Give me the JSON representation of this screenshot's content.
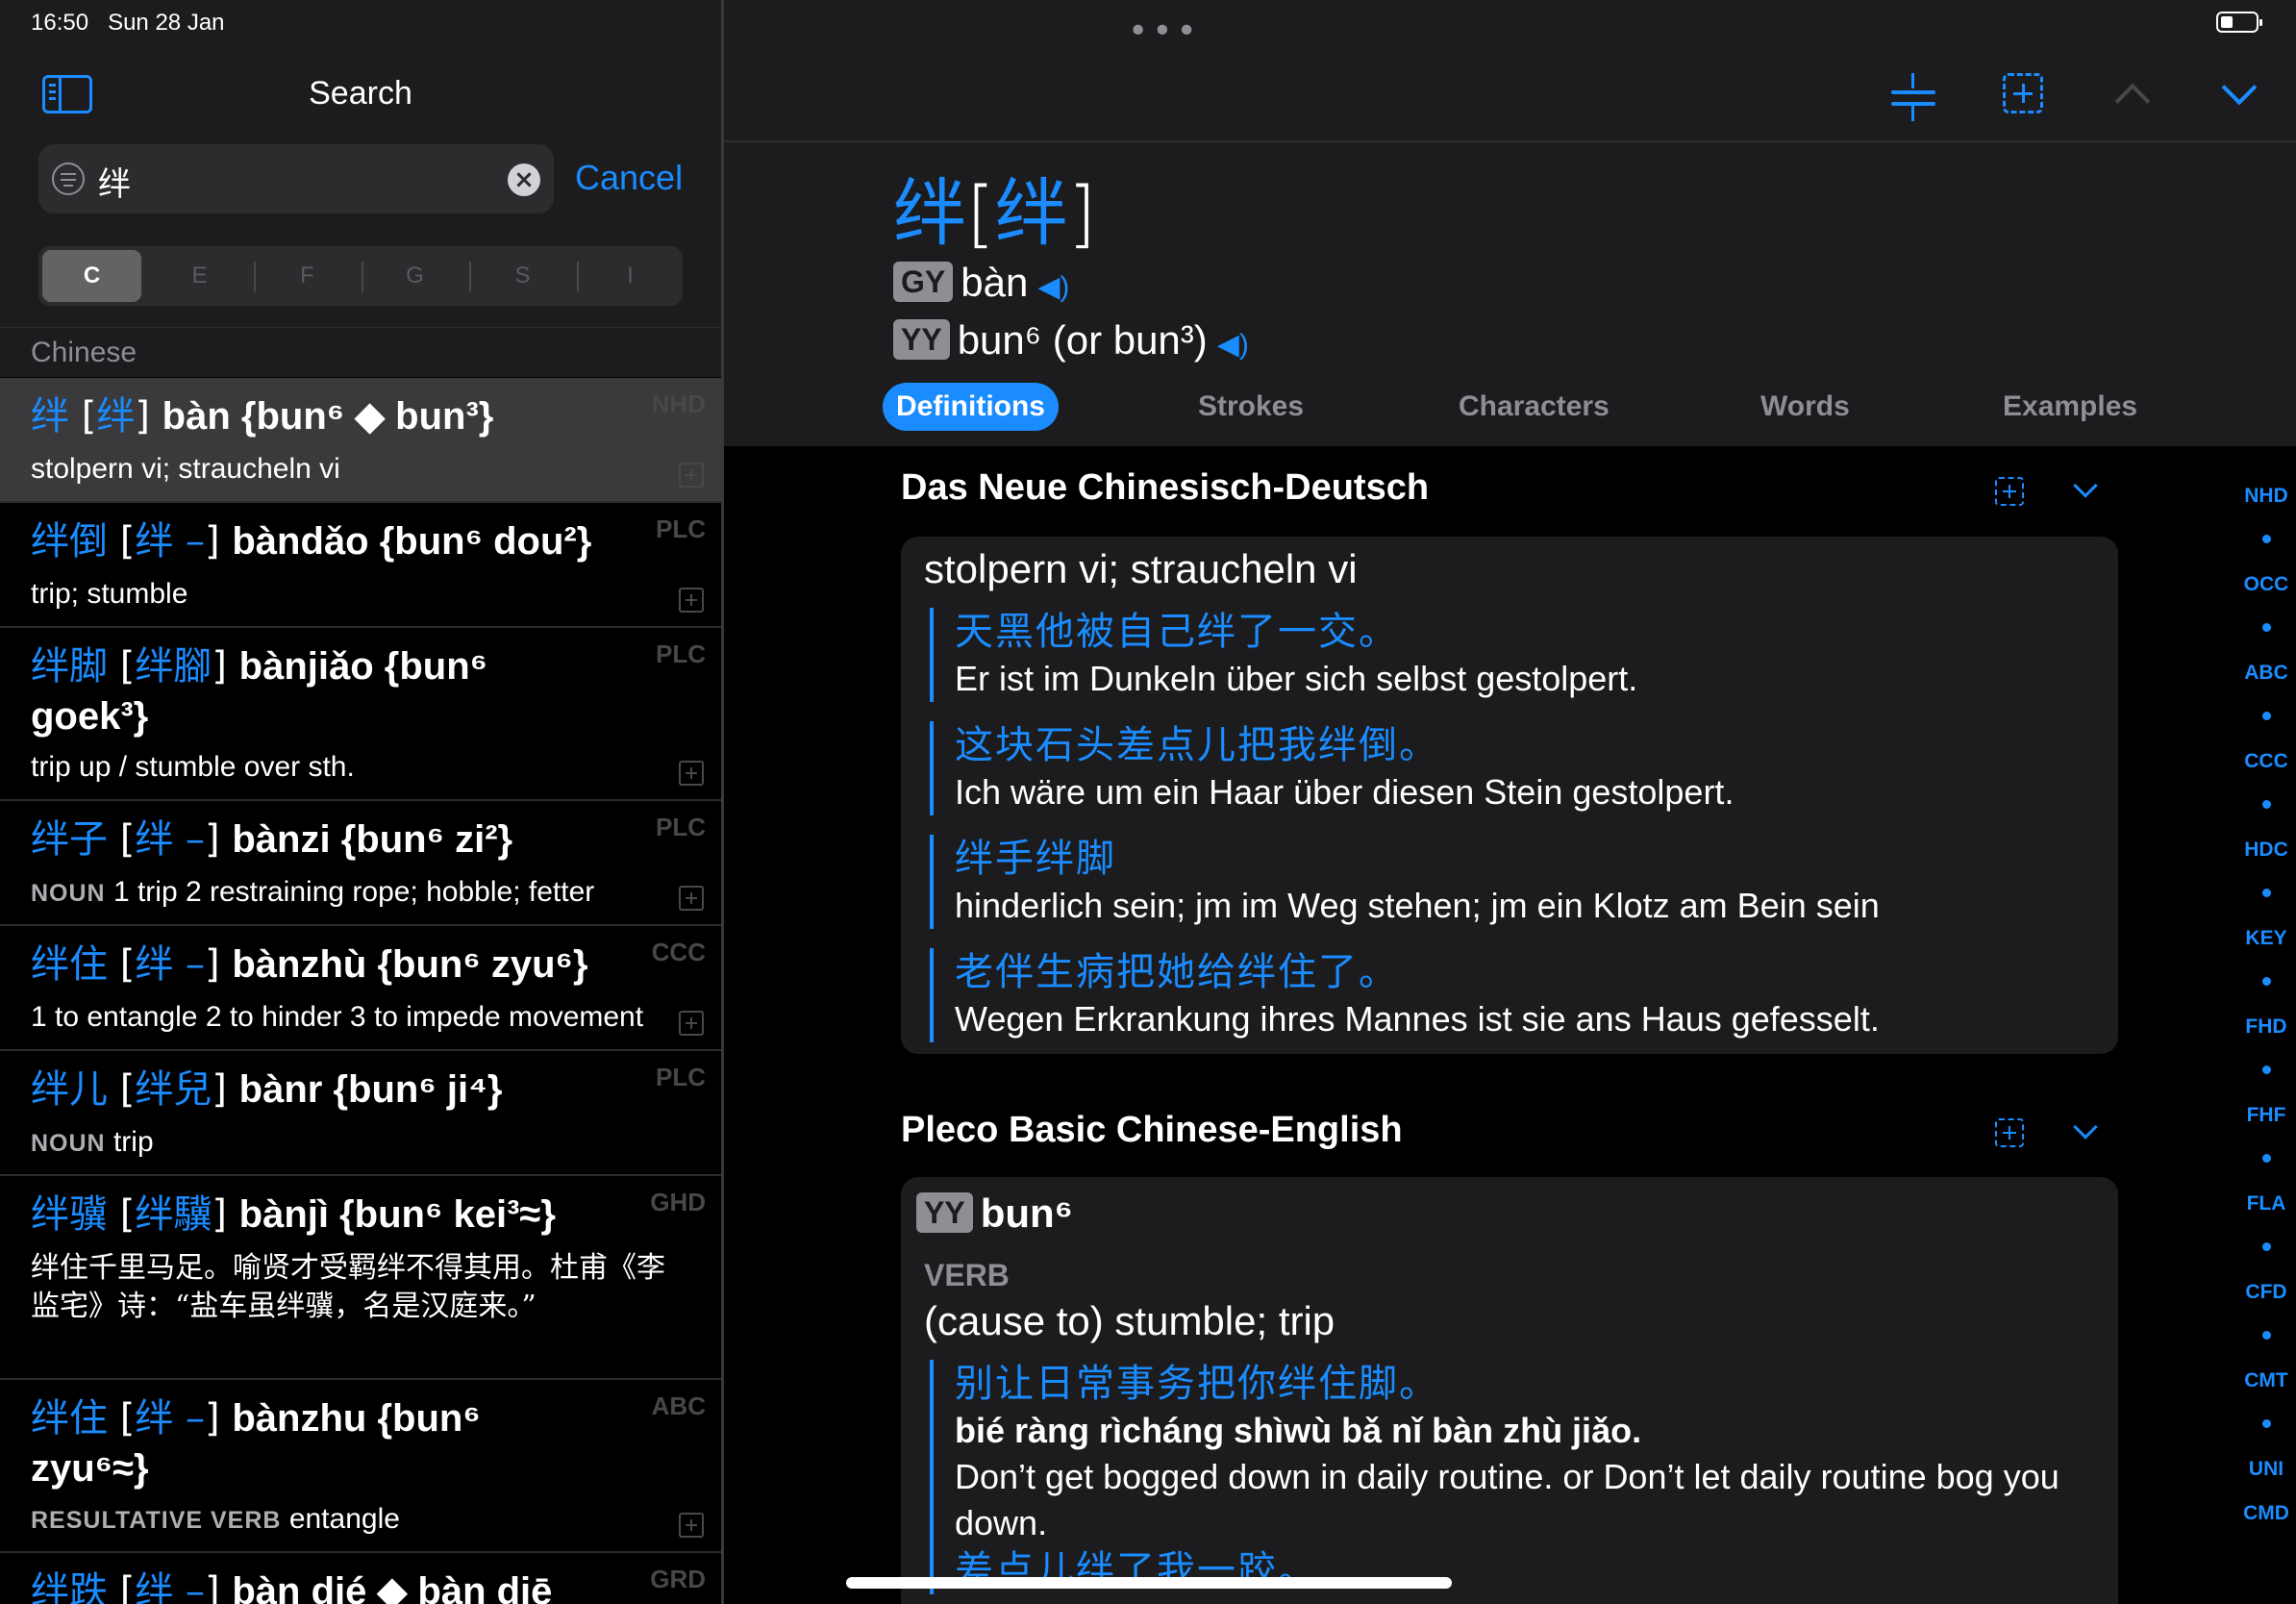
{
  "status": {
    "time": "16:50",
    "date": "Sun 28 Jan"
  },
  "search": {
    "title": "Search",
    "query": "绊",
    "cancel": "Cancel",
    "segments": [
      "C",
      "E",
      "F",
      "G",
      "S",
      "I"
    ],
    "active_segment": "C",
    "section": "Chinese"
  },
  "results": [
    {
      "hz": "绊",
      "trad": "绊",
      "py": "bàn {bun⁶ ◆ bun³}",
      "def": "stolpern vi; straucheln vi",
      "tag": "NHD"
    },
    {
      "hz": "绊倒",
      "trad": "绊 –",
      "py": "bàndǎo {bun⁶ dou²}",
      "def": "trip; stumble",
      "tag": "PLC"
    },
    {
      "hz": "绊脚",
      "trad": "绊腳",
      "py": "bànjiǎo {bun⁶",
      "py2": "goek³}",
      "def": "trip up / stumble over sth.",
      "tag": "PLC"
    },
    {
      "hz": "绊子",
      "trad": "绊 –",
      "py": "bànzi {bun⁶ zi²}",
      "pos": "NOUN",
      "def": "1 trip 2 restraining rope; hobble; fetter",
      "tag": "PLC"
    },
    {
      "hz": "绊住",
      "trad": "绊 –",
      "py": "bànzhù {bun⁶ zyu⁶}",
      "def": "1 to entangle 2 to hinder 3 to impede movement",
      "tag": "CCC"
    },
    {
      "hz": "绊儿",
      "trad": "绊兒",
      "py": "bànr {bun⁶ ji⁴}",
      "pos": "NOUN",
      "def": "trip",
      "tag": "PLC"
    },
    {
      "hz": "绊骥",
      "trad": "绊驥",
      "py": "bànjì {bun⁶ kei³≈}",
      "def": "绊住千里马足。喻贤才受羁绊不得其用。杜甫《李监宅》诗：“盐车虽绊骥，名是汉庭来。”",
      "tag": "GHD"
    },
    {
      "hz": "绊住",
      "trad": "绊 –",
      "py": "bànzhu {bun⁶",
      "py2": "zyu⁶≈}",
      "pos": "RESULTATIVE VERB",
      "def": "entangle",
      "tag": "ABC"
    },
    {
      "hz": "绊跌",
      "trad": "绊 –",
      "py": "bàn dié ◆ bàn diē",
      "tag": "GRD"
    }
  ],
  "entry": {
    "hz": "绊",
    "trad": "绊",
    "gy_badge": "GY",
    "gy": "bàn",
    "yy_badge": "YY",
    "yy": "bun⁶ (or bun³)"
  },
  "tabs": [
    "Definitions",
    "Strokes",
    "Characters",
    "Words",
    "Examples"
  ],
  "active_tab": "Definitions",
  "dict1": {
    "title": "Das Neue Chinesisch-Deutsch",
    "def": "stolpern vi; straucheln vi",
    "examples": [
      {
        "zh": "天黑他被自己绊了一交。",
        "tr": "Er ist im Dunkeln über sich selbst gestolpert."
      },
      {
        "zh": "这块石头差点儿把我绊倒。",
        "tr": "Ich wäre um ein Haar über diesen Stein gestolpert."
      },
      {
        "zh": "绊手绊脚",
        "tr": "hinderlich sein; jm im Weg stehen; jm ein Klotz am Bein sein"
      },
      {
        "zh": "老伴生病把她给绊住了。",
        "tr": "Wegen Erkrankung ihres Mannes ist sie ans Haus gefesselt."
      }
    ]
  },
  "dict2": {
    "title": "Pleco Basic Chinese-English",
    "badge": "YY",
    "yy": "bun⁶",
    "pos": "VERB",
    "def": "(cause to) stumble; trip",
    "ex_zh": "别让日常事务把你绊住脚。",
    "ex_py": "bié ràng rìcháng shìwù bǎ nǐ bàn zhù jiǎo.",
    "ex_tr": "Don’t get bogged down in daily routine. or Don’t let daily routine bog you down.",
    "ex2_zh": "差点儿绊了我一跤。"
  },
  "index": [
    "NHD",
    "OCC",
    "ABC",
    "CCC",
    "HDC",
    "KEY",
    "FHD",
    "FHF",
    "FLA",
    "CFD",
    "CMT",
    "UNI",
    "CMD"
  ],
  "colors": {
    "accent": "#1a8cff",
    "bg": "#000000",
    "panel": "#1c1c1e"
  }
}
